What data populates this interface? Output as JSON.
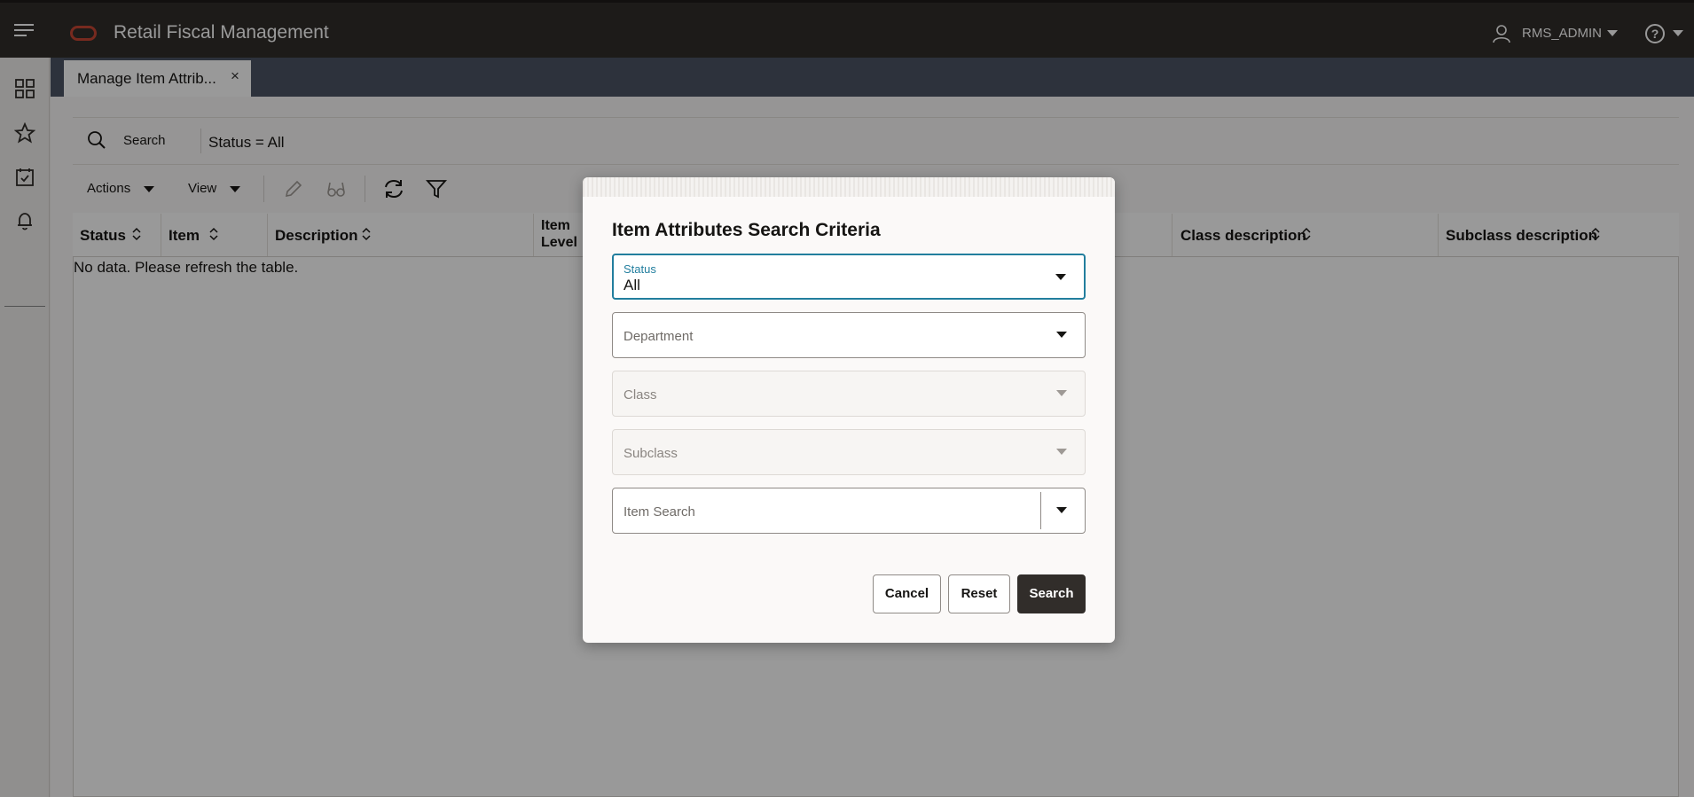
{
  "header": {
    "app_title": "Retail Fiscal Management",
    "user_name": "RMS_ADMIN"
  },
  "tabs": [
    {
      "label": "Manage Item Attrib...",
      "close": "×"
    }
  ],
  "search_bar": {
    "label": "Search",
    "filter": "Status = All"
  },
  "toolbar": {
    "actions_label": "Actions",
    "view_label": "View"
  },
  "grid": {
    "columns": [
      {
        "label": "Status"
      },
      {
        "label": "Item"
      },
      {
        "label": "Description"
      },
      {
        "label": "Item Level"
      },
      {
        "label": "Class description"
      },
      {
        "label": "Subclass description"
      }
    ],
    "empty_message": "No data. Please refresh the table."
  },
  "dialog": {
    "title": "Item Attributes Search Criteria",
    "fields": {
      "status_label": "Status",
      "status_value": "All",
      "department_label": "Department",
      "class_label": "Class",
      "subclass_label": "Subclass",
      "item_search_label": "Item Search"
    },
    "buttons": {
      "cancel": "Cancel",
      "reset": "Reset",
      "search": "Search"
    }
  },
  "colors": {
    "header_bg": "#312d2a",
    "tabbar_bg": "#4b5465",
    "accent": "#227e9e",
    "brand": "#c74634"
  },
  "icons": [
    "hamburger-icon",
    "oracle-logo",
    "user-icon",
    "help-icon",
    "dashboard-icon",
    "star-icon",
    "tasks-icon",
    "bell-icon",
    "search-icon",
    "edit-icon",
    "view-icon",
    "refresh-icon",
    "filter-icon",
    "sort-icon",
    "chevron-down-icon"
  ]
}
